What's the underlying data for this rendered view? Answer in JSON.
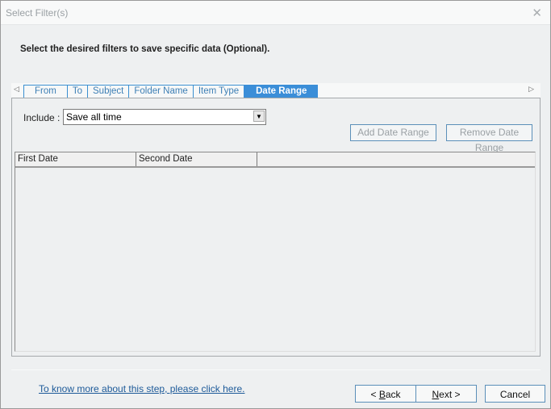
{
  "window": {
    "title": "Select Filter(s)",
    "close_icon": "close-icon"
  },
  "heading": "Select the desired filters to save specific data (Optional).",
  "tabs": [
    {
      "label": "From",
      "active": false
    },
    {
      "label": "To",
      "active": false
    },
    {
      "label": "Subject",
      "active": false
    },
    {
      "label": "Folder Name",
      "active": false
    },
    {
      "label": "Item Type",
      "active": false
    },
    {
      "label": "Date Range",
      "active": true
    }
  ],
  "tab_scroll": {
    "left": "◁",
    "right": "▷"
  },
  "include": {
    "label": "Include :",
    "value": "Save all time",
    "dropdown_icon": "▼"
  },
  "buttons": {
    "add_date_range": "Add Date Range",
    "remove_date_range": "Remove Date Range",
    "back_prefix": "< ",
    "back_accel": "B",
    "back_rest": "ack",
    "next_accel": "N",
    "next_rest": "ext >",
    "cancel": "Cancel"
  },
  "table": {
    "columns": [
      "First Date",
      "Second Date",
      ""
    ],
    "rows": []
  },
  "help_link": "To know more about this step, please click here.",
  "colors": {
    "accent": "#3b8ed8",
    "link": "#1d5a99"
  }
}
